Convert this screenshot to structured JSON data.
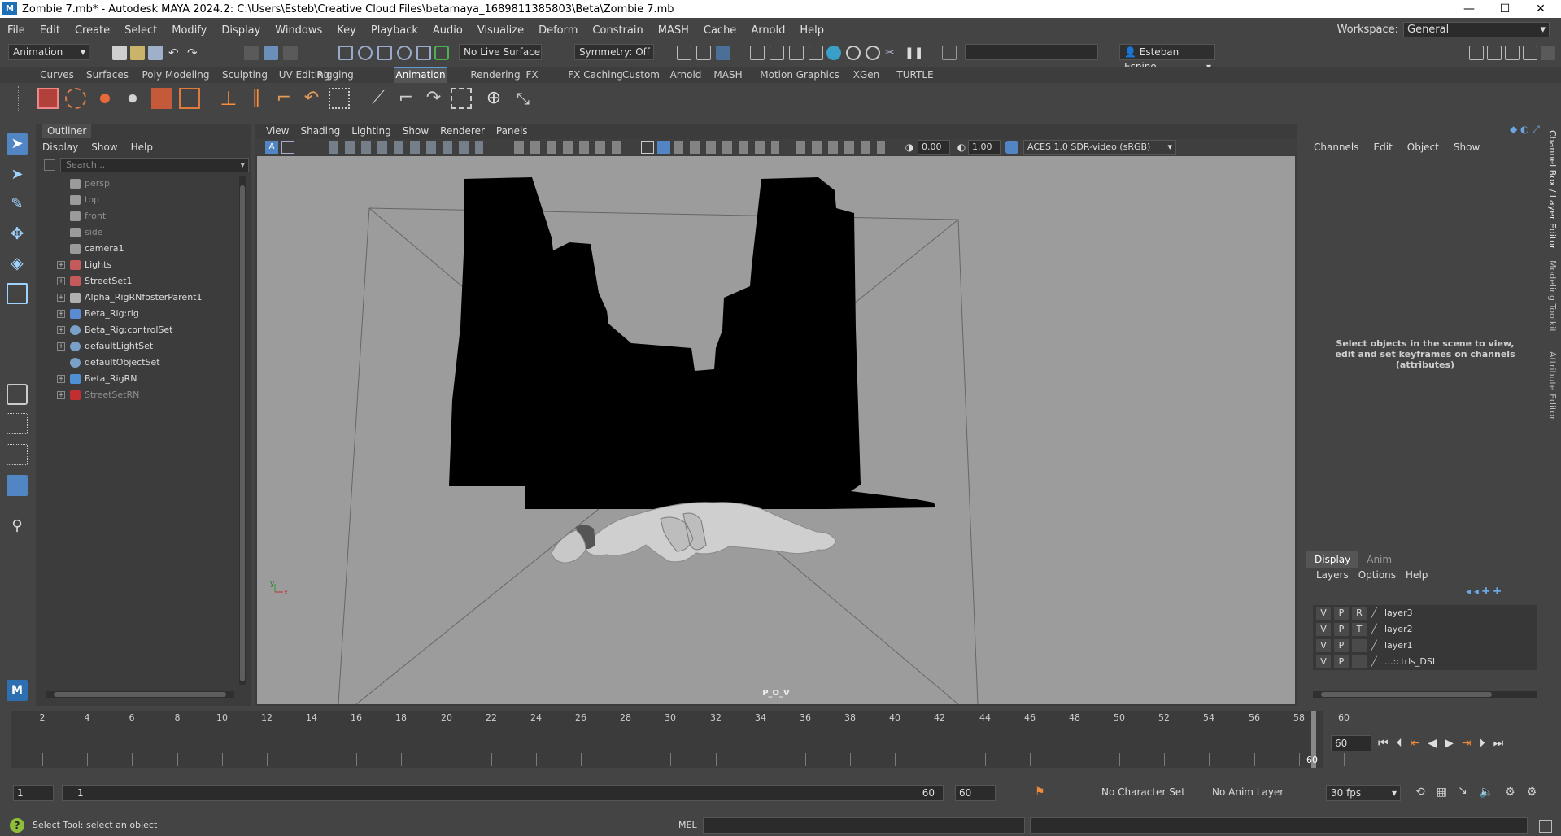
{
  "titlebar": {
    "title": "Zombie 7.mb* - Autodesk MAYA 2024.2: C:\\Users\\Esteb\\Creative Cloud Files\\betamaya_1689811385803\\Beta\\Zombie 7.mb",
    "minimize": "—",
    "maximize": "☐",
    "close": "✕"
  },
  "menubar": {
    "items": [
      "File",
      "Edit",
      "Create",
      "Select",
      "Modify",
      "Display",
      "Windows",
      "Key",
      "Playback",
      "Audio",
      "Visualize",
      "Deform",
      "Constrain",
      "MASH",
      "Cache",
      "Arnold",
      "Help"
    ],
    "workspace_label": "Workspace:",
    "workspace_value": "General"
  },
  "status": {
    "menuset": "Animation",
    "live_surface": "No Live Surface",
    "symmetry": "Symmetry: Off",
    "user": "Esteban Espino."
  },
  "shelf": {
    "tabs": [
      "Curves",
      "Surfaces",
      "Poly Modeling",
      "Sculpting",
      "UV Editing",
      "Rigging",
      "Animation",
      "Rendering",
      "FX",
      "FX Caching",
      "Custom",
      "Arnold",
      "MASH",
      "Motion Graphics",
      "XGen",
      "TURTLE"
    ],
    "active": "Animation"
  },
  "outliner": {
    "title": "Outliner",
    "menu": [
      "Display",
      "Show",
      "Help"
    ],
    "search_placeholder": "Search...",
    "items": [
      {
        "label": "persp",
        "icon": "camera-icon",
        "dim": true,
        "expand": false
      },
      {
        "label": "top",
        "icon": "camera-icon",
        "dim": true,
        "expand": false
      },
      {
        "label": "front",
        "icon": "camera-icon",
        "dim": true,
        "expand": false
      },
      {
        "label": "side",
        "icon": "camera-icon",
        "dim": true,
        "expand": false
      },
      {
        "label": "camera1",
        "icon": "camera-icon",
        "dim": false,
        "expand": false
      },
      {
        "label": "Lights",
        "icon": "set-icon",
        "dim": false,
        "expand": true
      },
      {
        "label": "StreetSet1",
        "icon": "set-icon",
        "dim": false,
        "expand": true
      },
      {
        "label": "Alpha_RigRNfosterParent1",
        "icon": "transform-icon",
        "dim": false,
        "expand": true
      },
      {
        "label": "Beta_Rig:rig",
        "icon": "rig-icon",
        "dim": false,
        "expand": true
      },
      {
        "label": "Beta_Rig:controlSet",
        "icon": "objectset-icon",
        "dim": false,
        "expand": true
      },
      {
        "label": "defaultLightSet",
        "icon": "objectset-icon",
        "dim": false,
        "expand": true
      },
      {
        "label": "defaultObjectSet",
        "icon": "objectset-icon",
        "dim": false,
        "expand": false
      },
      {
        "label": "Beta_RigRN",
        "icon": "reference-icon",
        "dim": false,
        "expand": true
      },
      {
        "label": "StreetSetRN",
        "icon": "unloaded-reference-icon",
        "dim": true,
        "expand": true
      }
    ]
  },
  "viewport": {
    "menu": [
      "View",
      "Shading",
      "Lighting",
      "Show",
      "Renderer",
      "Panels"
    ],
    "near": "0.00",
    "far": "1.00",
    "colorspace": "ACES 1.0 SDR-video (sRGB)",
    "camera_label": "P_O_V"
  },
  "channelbox": {
    "menu": [
      "Channels",
      "Edit",
      "Object",
      "Show"
    ],
    "hint": "Select objects in the scene to view, edit and set keyframes on channels (attributes)"
  },
  "layers": {
    "tabs": [
      "Display",
      "Anim"
    ],
    "menu": [
      "Layers",
      "Options",
      "Help"
    ],
    "rows": [
      {
        "v": "V",
        "p": "P",
        "r": "R",
        "name": "layer3"
      },
      {
        "v": "V",
        "p": "P",
        "r": "T",
        "name": "layer2"
      },
      {
        "v": "V",
        "p": "P",
        "r": "",
        "name": "layer1"
      },
      {
        "v": "V",
        "p": "P",
        "r": "",
        "name": "...:ctrls_DSL"
      }
    ]
  },
  "sidebar_tabs": [
    "Channel Box / Layer Editor",
    "Modeling Toolkit",
    "Attribute Editor"
  ],
  "timeline": {
    "ticks": [
      "2",
      "4",
      "6",
      "8",
      "10",
      "12",
      "14",
      "16",
      "18",
      "20",
      "22",
      "24",
      "26",
      "28",
      "30",
      "32",
      "34",
      "36",
      "38",
      "40",
      "42",
      "44",
      "46",
      "48",
      "50",
      "52",
      "54",
      "56",
      "58",
      "60"
    ],
    "end_label": "60",
    "current_frame": "60"
  },
  "range": {
    "start": "1",
    "inner_start": "1",
    "inner_end": "60",
    "end": "60",
    "character_set": "No Character Set",
    "anim_layer": "No Anim Layer",
    "fps": "30 fps"
  },
  "cmd": {
    "help": "Select Tool: select an object",
    "lang": "MEL"
  }
}
